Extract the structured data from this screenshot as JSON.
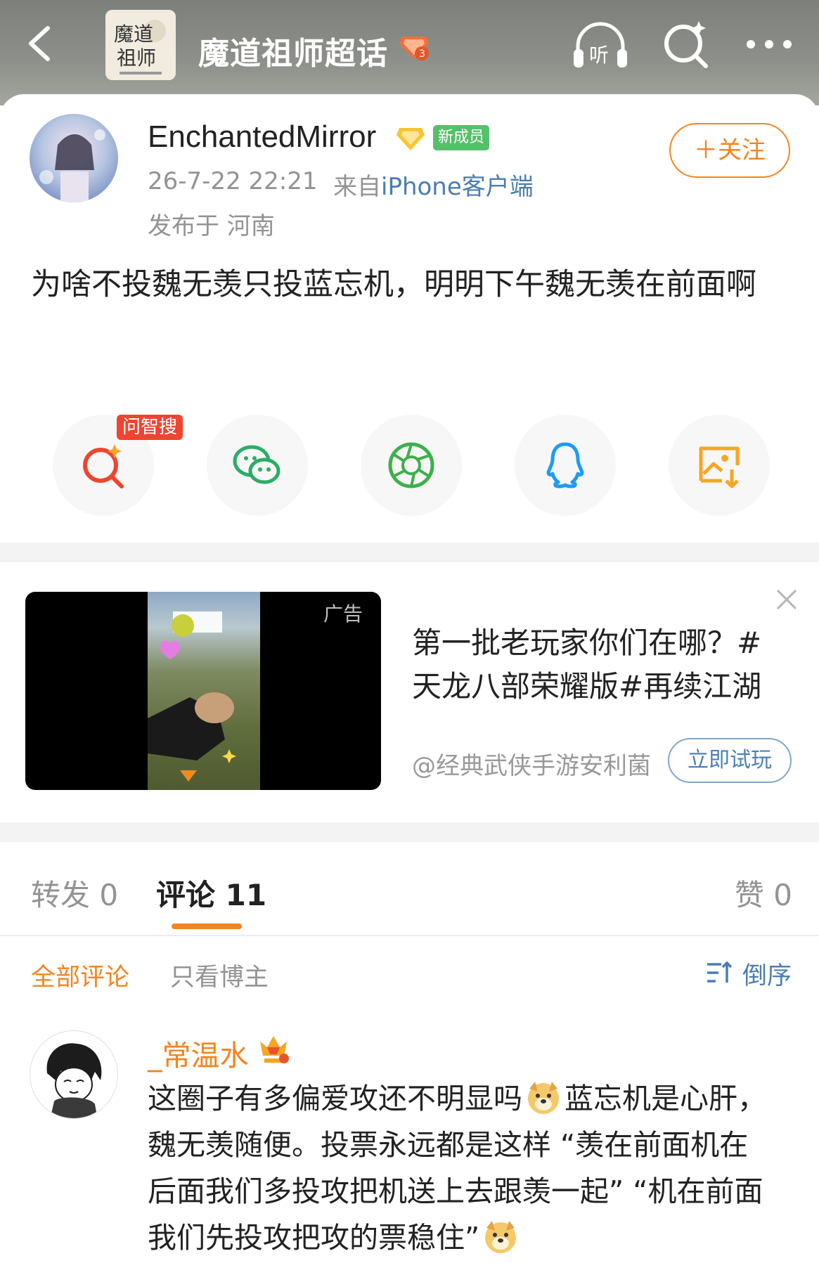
{
  "header": {
    "title": "魔道祖师超话",
    "cover_text": "魔道祖师"
  },
  "post": {
    "username": "EnchantedMirror",
    "new_member_badge": "新成员",
    "follow_label": "＋关注",
    "time": "26-7-22 22:21",
    "from_prefix": "来自",
    "from_device": "iPhone客户端",
    "location": "发布于 河南",
    "body": "为啥不投魏无羡只投蓝忘机，明明下午魏无羡在前面啊"
  },
  "share": {
    "zhisou_tag": "问智搜",
    "items": [
      "ai-search-icon",
      "wechat-icon",
      "moments-icon",
      "qq-icon",
      "save-image-icon"
    ]
  },
  "ad": {
    "tag": "广告",
    "title": "第一批老玩家你们在哪？#天龙八部荣耀版#再续江湖",
    "account": "@经典武侠手游安利菌",
    "cta": "立即试玩"
  },
  "tabs": {
    "repost": "转发 0",
    "comment": "评论 11",
    "like": "赞 0"
  },
  "filters": {
    "all": "全部评论",
    "op_only": "只看博主",
    "sort": "倒序"
  },
  "comment": {
    "username": "_常温水",
    "text_1": "这圈子有多偏爱攻还不明显吗",
    "text_2": "蓝忘机是心肝，魏无羡随便。投票永远都是这样 “羡在前面机在后面我们多投攻把机送上去跟羡一起” “机在前面我们先投攻把攻的票稳住”"
  },
  "colors": {
    "accent": "#f5841f",
    "link": "#4a7db3",
    "muted": "#939393"
  }
}
